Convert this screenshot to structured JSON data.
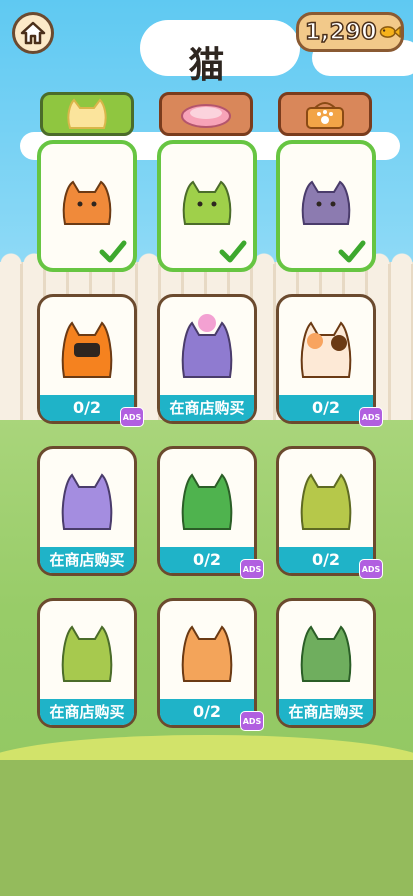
{
  "header": {
    "title": "猫",
    "coins": "1,290",
    "home_icon": "home-icon",
    "coin_icon": "fish-icon"
  },
  "tabs": [
    {
      "label": "cats",
      "icon": "cat-face-icon",
      "active": true
    },
    {
      "label": "beds",
      "icon": "cat-bed-icon",
      "active": false
    },
    {
      "label": "baskets",
      "icon": "paw-basket-icon",
      "active": false
    }
  ],
  "owned": [
    {
      "name": "orange-tabby",
      "color": "#f08a3a"
    },
    {
      "name": "green-fluffy",
      "color": "#9fd04a"
    },
    {
      "name": "purple-grumpy",
      "color": "#8c7bb0"
    }
  ],
  "cards": [
    {
      "footer": "0/2",
      "ads": "ADS",
      "color": "#f5821f"
    },
    {
      "footer": "在商店购买",
      "color": "#8f7bd0"
    },
    {
      "footer": "0/2",
      "ads": "ADS",
      "color": "#f8a460"
    },
    {
      "footer": "在商店购买",
      "color": "#a48de0"
    },
    {
      "footer": "0/2",
      "ads": "ADS",
      "color": "#4fb34e"
    },
    {
      "footer": "0/2",
      "ads": "ADS",
      "color": "#b6c84a"
    },
    {
      "footer": "在商店购买",
      "color": "#a7c94e"
    },
    {
      "footer": "0/2",
      "ads": "ADS",
      "color": "#f3a45a"
    },
    {
      "footer": "在商店购买",
      "color": "#6fae5e"
    }
  ]
}
